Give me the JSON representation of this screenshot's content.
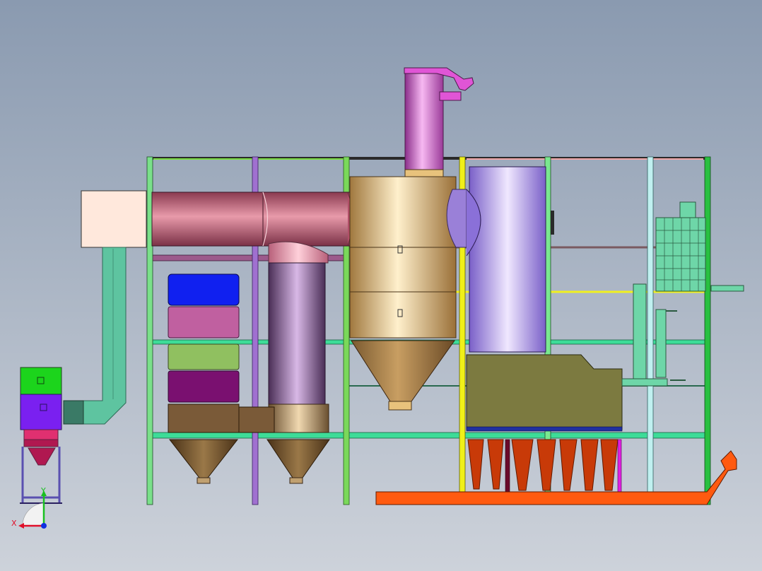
{
  "viewport": {
    "background_top": "#8A9AB0",
    "background_bottom": "#C9CFD8"
  },
  "triad": {
    "x_label": "X",
    "y_label": "Y",
    "x_color": "#E0102A",
    "y_color": "#18C020",
    "z_color": "#1030E0"
  },
  "palette": {
    "duct_green": "#5EC4A0",
    "inlet_box": "#FFE8DC",
    "frame_green": "#3DDC98",
    "stack_pink": "#E055D6",
    "cyclone_tan": "#E8C27C",
    "tower_lavender": "#A894E8",
    "hopper_brown": "#7A5A38",
    "scraper_orange": "#FF5A10",
    "fan_green": "#1CD41C",
    "fan_purple": "#7A20F0",
    "bag_green": "#6ED6A8",
    "collector_olive": "#7C7A40"
  }
}
